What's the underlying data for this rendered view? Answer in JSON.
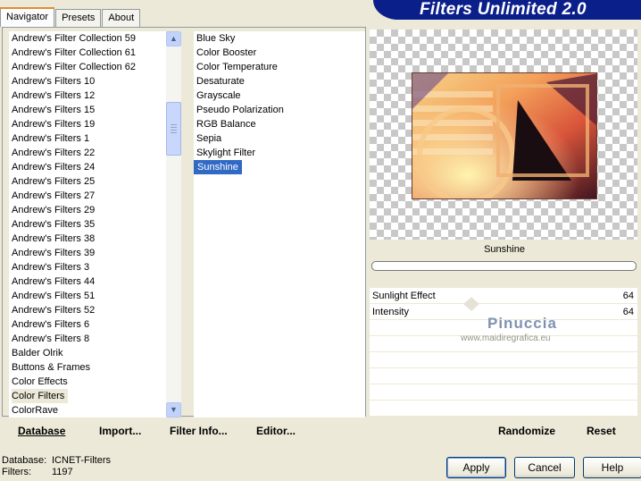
{
  "tabs": [
    {
      "label": "Navigator"
    },
    {
      "label": "Presets"
    },
    {
      "label": "About"
    }
  ],
  "banner": {
    "title": "Filters Unlimited 2.0"
  },
  "categories": {
    "items": [
      "Andrew's Filter Collection 59",
      "Andrew's Filter Collection 61",
      "Andrew's Filter Collection 62",
      "Andrew's Filters 10",
      "Andrew's Filters 12",
      "Andrew's Filters 15",
      "Andrew's Filters 19",
      "Andrew's Filters 1",
      "Andrew's Filters 22",
      "Andrew's Filters 24",
      "Andrew's Filters 25",
      "Andrew's Filters 27",
      "Andrew's Filters 29",
      "Andrew's Filters 35",
      "Andrew's Filters 38",
      "Andrew's Filters 39",
      "Andrew's Filters 3",
      "Andrew's Filters 44",
      "Andrew's Filters 51",
      "Andrew's Filters 52",
      "Andrew's Filters 6",
      "Andrew's Filters 8",
      "Balder Olrik",
      "Buttons & Frames",
      "Color Effects",
      "Color Filters",
      "ColorRave"
    ],
    "selected": "Color Filters"
  },
  "filters": {
    "items": [
      "Blue Sky",
      "Color Booster",
      "Color Temperature",
      "Desaturate",
      "Grayscale",
      "Pseudo Polarization",
      "RGB Balance",
      "Sepia",
      "Skylight Filter",
      "Sunshine"
    ],
    "selected": "Sunshine"
  },
  "left_buttons": {
    "database": "Database",
    "import": "Import...",
    "filter_info": "Filter Info...",
    "editor": "Editor..."
  },
  "preview": {
    "filter_name": "Sunshine"
  },
  "sliders": [
    {
      "label": "Sunlight Effect",
      "value": "64",
      "level": 0.25
    },
    {
      "label": "Intensity",
      "value": "64",
      "level": 0.25
    }
  ],
  "watermark": {
    "name": "Pinuccia",
    "url": "www.maidiregrafica.eu"
  },
  "right_buttons": {
    "randomize": "Randomize",
    "reset": "Reset"
  },
  "status": {
    "database_label": "Database:",
    "database_value": "ICNET-Filters",
    "filters_label": "Filters:",
    "filters_value": "1197"
  },
  "dialog_buttons": {
    "apply": "Apply",
    "cancel": "Cancel",
    "help": "Help"
  },
  "colors": {
    "banner": "#0b1f8a",
    "selection": "#316ac5",
    "face": "#ece9d8"
  }
}
